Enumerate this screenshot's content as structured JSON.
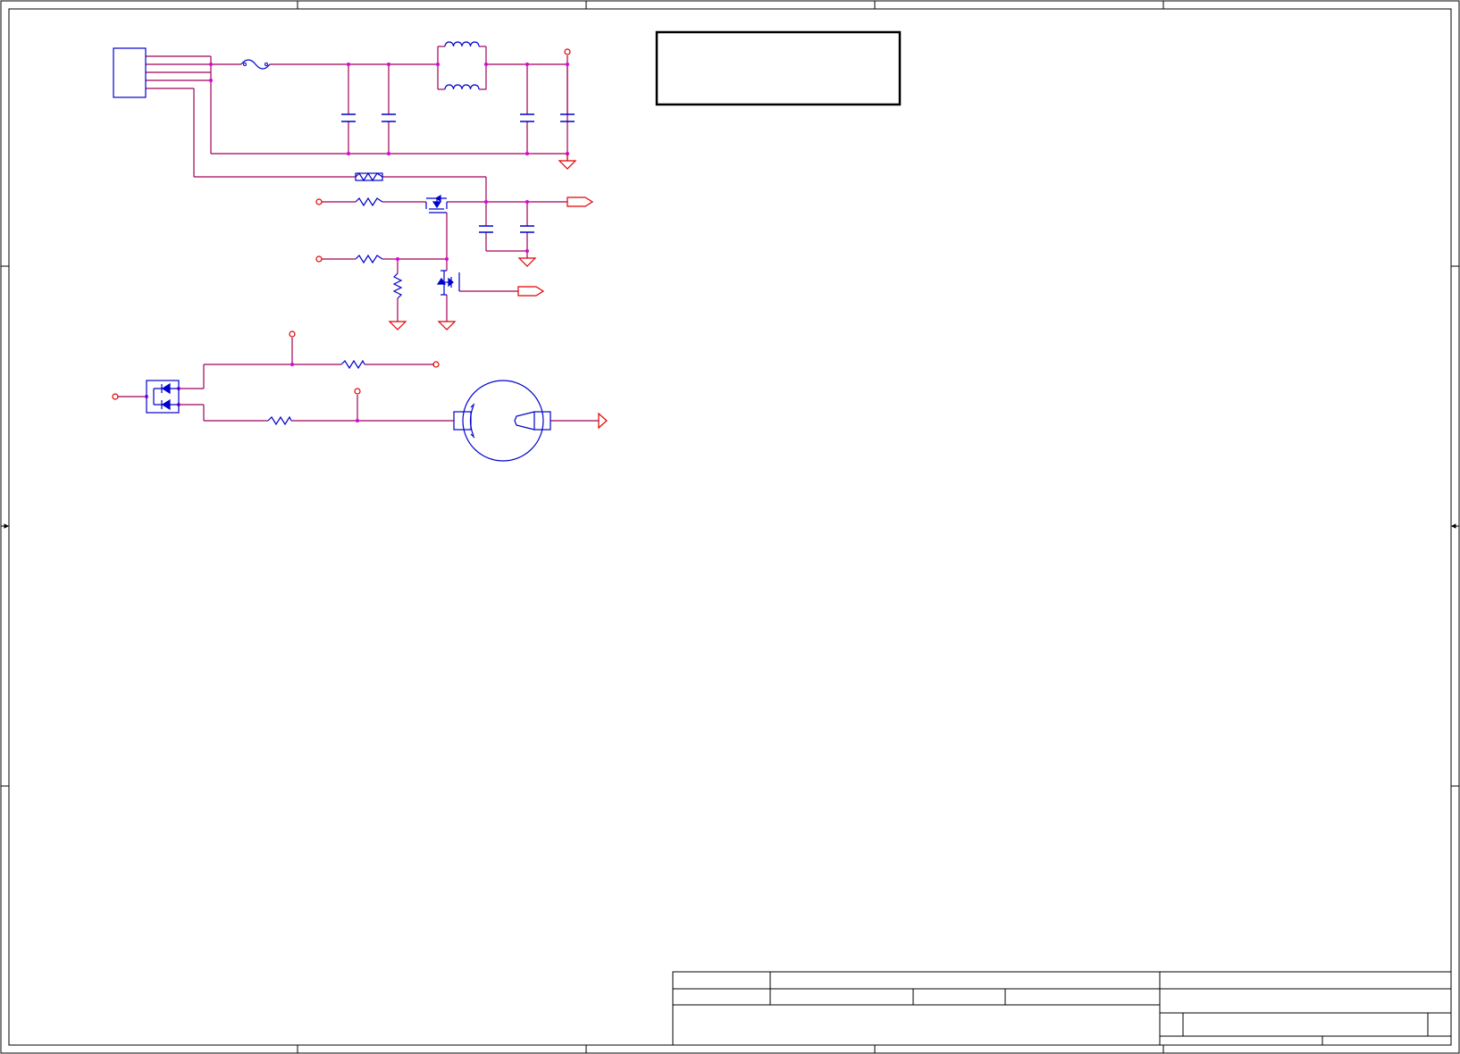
{
  "colors": {
    "wire": "#a0005a",
    "component": "#0000cc",
    "power_port": "#e00000",
    "junction": "#e000e0",
    "frame": "#000000"
  },
  "title_block": {
    "title": "",
    "sheet": "",
    "revision": "",
    "date": ""
  },
  "icons": [
    "connector",
    "fuse",
    "capacitor",
    "inductor",
    "resistor",
    "mosfet",
    "ground",
    "power-port",
    "diode-pair",
    "battery-holder"
  ]
}
